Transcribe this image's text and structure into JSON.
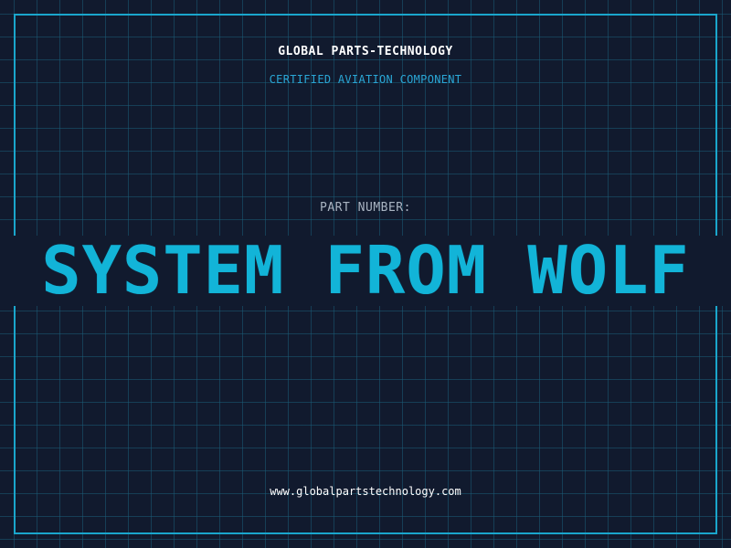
{
  "header": {
    "company": "GLOBAL PARTS-TECHNOLOGY",
    "subtitle": "CERTIFIED AVIATION COMPONENT"
  },
  "part": {
    "label": "PART NUMBER:",
    "value": "SYSTEM FROM WOLF"
  },
  "footer": {
    "url": "www.globalpartstechnology.com"
  },
  "colors": {
    "background": "#111a2e",
    "grid": "#1a5c76",
    "frame": "#1aa6cc",
    "accent": "#12b4d8"
  }
}
